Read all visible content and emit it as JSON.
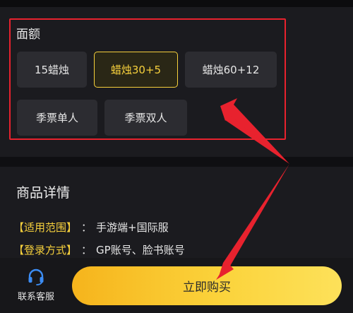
{
  "denomination": {
    "title": "面额",
    "options": [
      {
        "label": "15蜡烛",
        "selected": false
      },
      {
        "label": "蜡烛30+5",
        "selected": true
      },
      {
        "label": "蜡烛60+12",
        "selected": false
      },
      {
        "label": "季票单人",
        "selected": false
      },
      {
        "label": "季票双人",
        "selected": false
      }
    ]
  },
  "details": {
    "title": "商品详情",
    "rows": [
      {
        "key": "【适用范围】",
        "sep": "：",
        "value": "手游端+国际服"
      },
      {
        "key": "【登录方式】",
        "sep": "：",
        "value": "GP账号、脸书账号"
      }
    ]
  },
  "bottom": {
    "customer_service_label": "联系客服",
    "buy_label": "立即购买"
  },
  "colors": {
    "accent": "#f6d03c",
    "highlight_red": "#e8222e",
    "background": "#131316",
    "panel": "#1b1b1f"
  },
  "icons": {
    "customer_service": "headset-icon"
  }
}
